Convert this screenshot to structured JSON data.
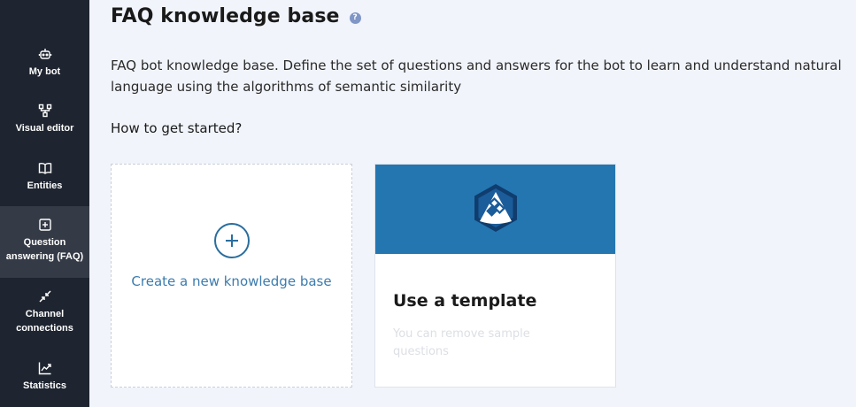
{
  "sidebar": {
    "items": [
      {
        "label": "My bot",
        "icon": "robot-icon"
      },
      {
        "label": "Visual editor",
        "icon": "flow-diagram-icon"
      },
      {
        "label": "Entities",
        "icon": "book-icon"
      },
      {
        "label": "Question answering (FAQ)",
        "icon": "faq-icon",
        "active": true
      },
      {
        "label": "Channel connections",
        "icon": "arrows-connect-icon"
      },
      {
        "label": "Statistics",
        "icon": "chart-line-icon"
      }
    ]
  },
  "header": {
    "title": "FAQ knowledge base",
    "help_icon": "?"
  },
  "main": {
    "description": "FAQ bot knowledge base. Define the set of questions and answers for the bot to learn and understand natural language using the algorithms of semantic similarity",
    "how_to_start": "How to get started?",
    "create_card": {
      "label": "Create a new knowledge base",
      "icon": "plus-circle-icon"
    },
    "template_card": {
      "title": "Use a template",
      "subtitle": "You can remove sample questions",
      "icon": "template-hexagon-icon"
    }
  },
  "colors": {
    "sidebar_bg": "#1f2530",
    "sidebar_active": "#353b46",
    "page_bg": "#f1f4fb",
    "accent": "#2476b1",
    "link": "#3c7cae"
  }
}
